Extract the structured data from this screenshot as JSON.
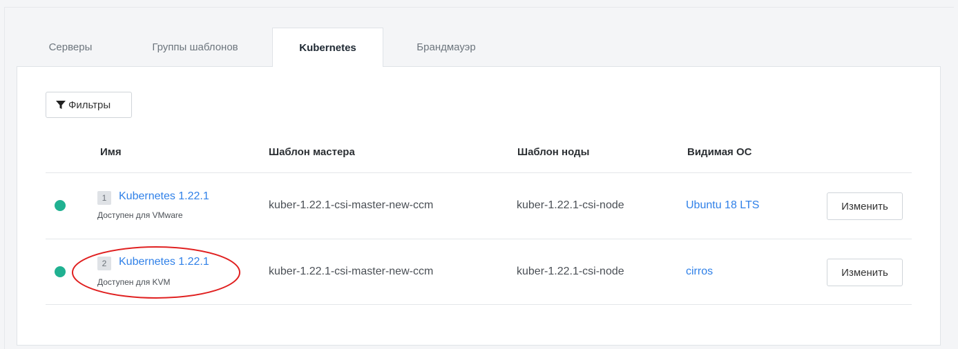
{
  "tabs": [
    {
      "label": "Серверы",
      "active": false
    },
    {
      "label": "Группы шаблонов",
      "active": false
    },
    {
      "label": "Kubernetes",
      "active": true
    },
    {
      "label": "Брандмауэр",
      "active": false
    }
  ],
  "toolbar": {
    "filter_label": "Фильтры",
    "filter_icon": "filter-icon"
  },
  "table": {
    "columns": [
      "Имя",
      "Шаблон мастера",
      "Шаблон ноды",
      "Видимая ОС"
    ],
    "rows": [
      {
        "status_color": "#20b191",
        "index": "1",
        "name": "Kubernetes 1.22.1",
        "availability": "Доступен для VMware",
        "master_template": "kuber-1.22.1-csi-master-new-ccm",
        "node_template": "kuber-1.22.1-csi-node",
        "os": "Ubuntu 18 LTS",
        "action": "Изменить"
      },
      {
        "status_color": "#20b191",
        "index": "2",
        "name": "Kubernetes 1.22.1",
        "availability": "Доступен для KVM",
        "master_template": "kuber-1.22.1-csi-master-new-ccm",
        "node_template": "kuber-1.22.1-csi-node",
        "os": "cirros",
        "action": "Изменить"
      }
    ]
  },
  "colors": {
    "accent": "#2f80e8",
    "status_ok": "#20b191",
    "annotation": "#e02020"
  }
}
